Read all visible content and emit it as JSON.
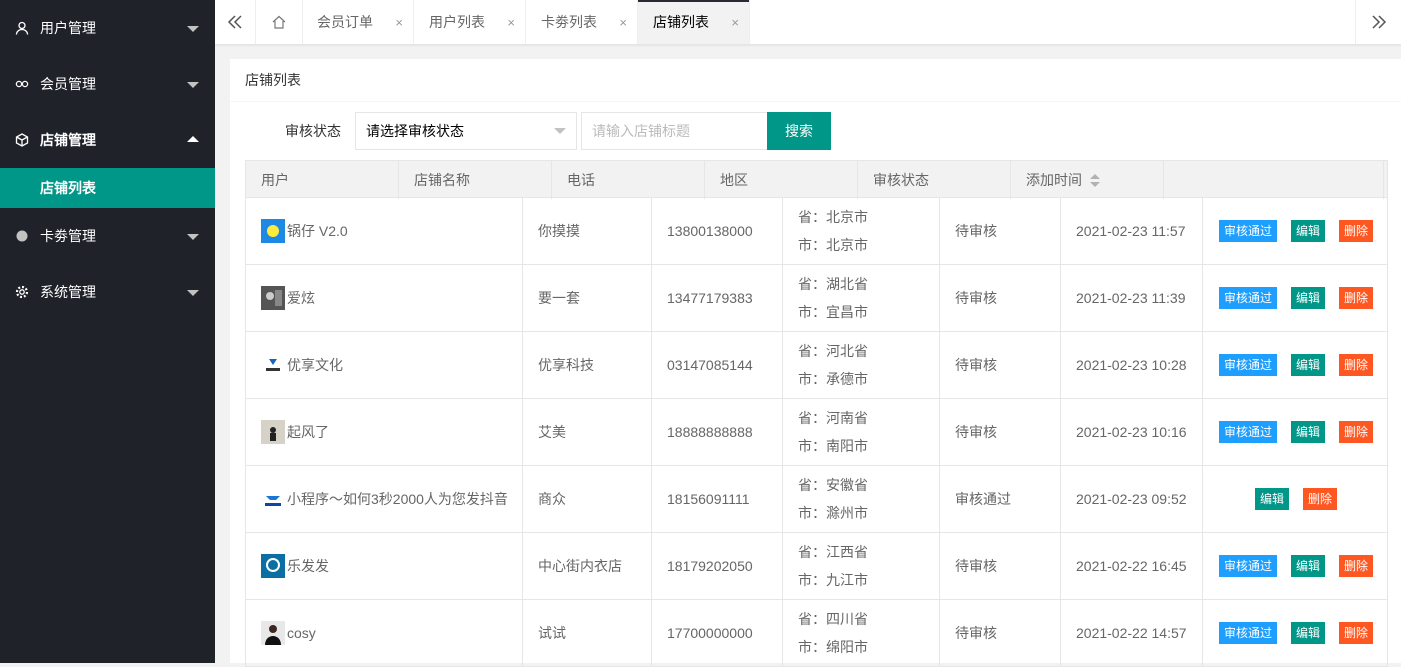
{
  "sidebar": {
    "items": [
      {
        "label": "用户管理",
        "icon": "user-icon"
      },
      {
        "label": "会员管理",
        "icon": "link-icon"
      },
      {
        "label": "店铺管理",
        "icon": "cube-icon",
        "children": [
          {
            "label": "店铺列表"
          }
        ]
      },
      {
        "label": "卡劵管理",
        "icon": "circle-icon"
      },
      {
        "label": "系统管理",
        "icon": "gear-icon"
      }
    ]
  },
  "tabs": {
    "prev_icon": "double-chevron-left-icon",
    "home_icon": "home-icon",
    "next_icon": "double-chevron-right-icon",
    "close_glyph": "×",
    "items": [
      {
        "label": "会员订单"
      },
      {
        "label": "用户列表"
      },
      {
        "label": "卡劵列表"
      },
      {
        "label": "店铺列表",
        "active": true
      }
    ]
  },
  "card": {
    "title": "店铺列表"
  },
  "filter": {
    "status_label": "审核状态",
    "status_value": "请选择审核状态",
    "title_placeholder": "请输入店铺标题",
    "search_label": "搜索"
  },
  "table": {
    "columns": [
      "用户",
      "店铺名称",
      "电话",
      "地区",
      "审核状态",
      "添加时间"
    ],
    "rows": [
      {
        "user": "锅仔 V2.0",
        "shop": "你摸摸",
        "phone": "13800138000",
        "province": "省：北京市",
        "city": "市：北京市",
        "status": "待审核",
        "time": "2021-02-23 11:57",
        "approve": true
      },
      {
        "user": "爱炫",
        "shop": "要一套",
        "phone": "13477179383",
        "province": "省：湖北省",
        "city": "市：宜昌市",
        "status": "待审核",
        "time": "2021-02-23 11:39",
        "approve": true
      },
      {
        "user": "优享文化",
        "shop": "优享科技",
        "phone": "03147085144",
        "province": "省：河北省",
        "city": "市：承德市",
        "status": "待审核",
        "time": "2021-02-23 10:28",
        "approve": true
      },
      {
        "user": "起风了",
        "shop": "艾美",
        "phone": "18888888888",
        "province": "省：河南省",
        "city": "市：南阳市",
        "status": "待审核",
        "time": "2021-02-23 10:16",
        "approve": true
      },
      {
        "user": "小程序～如何3秒2000人为您发抖音",
        "shop": "商众",
        "phone": "18156091111",
        "province": "省：安徽省",
        "city": "市：滁州市",
        "status": "审核通过",
        "time": "2021-02-23 09:52",
        "approve": false
      },
      {
        "user": "乐发发",
        "shop": "中心街内衣店",
        "phone": "18179202050",
        "province": "省：江西省",
        "city": "市：九江市",
        "status": "待审核",
        "time": "2021-02-22 16:45",
        "approve": true
      },
      {
        "user": "cosy",
        "shop": "试试",
        "phone": "17700000000",
        "province": "省：四川省",
        "city": "市：绵阳市",
        "status": "待审核",
        "time": "2021-02-22 14:57",
        "approve": true
      }
    ],
    "actions": {
      "approve": "审核通过",
      "edit": "编辑",
      "delete": "删除"
    }
  },
  "colors": {
    "sidebar_bg": "#20222a",
    "accent": "#009688",
    "approve": "#1e9fff",
    "delete": "#ff5722"
  }
}
